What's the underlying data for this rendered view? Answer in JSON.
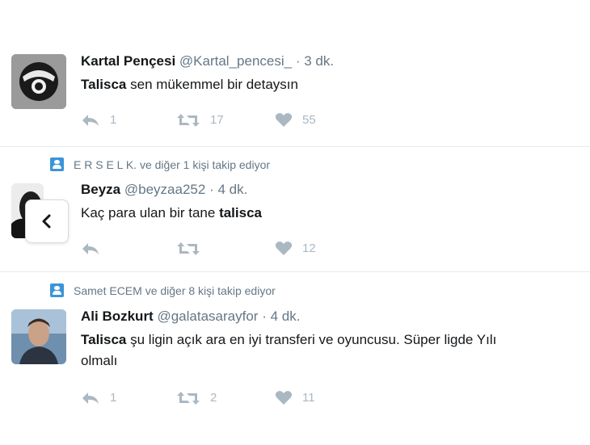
{
  "tweets": [
    {
      "social": "",
      "name": "Kartal Pençesi",
      "handle": "@Kartal_pencesi_",
      "time": "3 dk.",
      "text_bold": "Talisca",
      "text_rest": " sen mükemmel bir detaysın",
      "text_line2": "",
      "replies": "1",
      "retweets": "17",
      "likes": "55",
      "avatar": "black-white-kartal-logo"
    },
    {
      "social": "E R S E L K. ve diğer 1 kişi takip ediyor",
      "name": "Beyza",
      "handle": "@beyzaa252",
      "time": "4 dk.",
      "text_pre": "Kaç para ulan bir tane ",
      "text_bold": "talisca",
      "replies": "",
      "retweets": "",
      "likes": "12",
      "avatar": "dark-hair-portrait"
    },
    {
      "social": "Samet ECEM ve diğer 8 kişi takip ediyor",
      "name": "Ali Bozkurt",
      "handle": "@galatasarayfor",
      "time": "4 dk.",
      "text_bold": "Talisca",
      "text_rest": " şu ligin açık ara en iyi transferi ve oyuncusu. Süper ligde Yılı",
      "text_line2": "olmalı",
      "replies": "1",
      "retweets": "2",
      "likes": "11",
      "avatar": "man-portrait"
    }
  ],
  "separator": "·",
  "colors": {
    "social_icon": "#3b94d9",
    "action": "#aab8c2",
    "muted": "#657786",
    "divider": "#e6ecf0"
  },
  "icons": {
    "reply": "reply-icon",
    "retweet": "retweet-icon",
    "like": "heart-icon",
    "back": "chevron-left-icon",
    "social": "person-follow-icon"
  }
}
